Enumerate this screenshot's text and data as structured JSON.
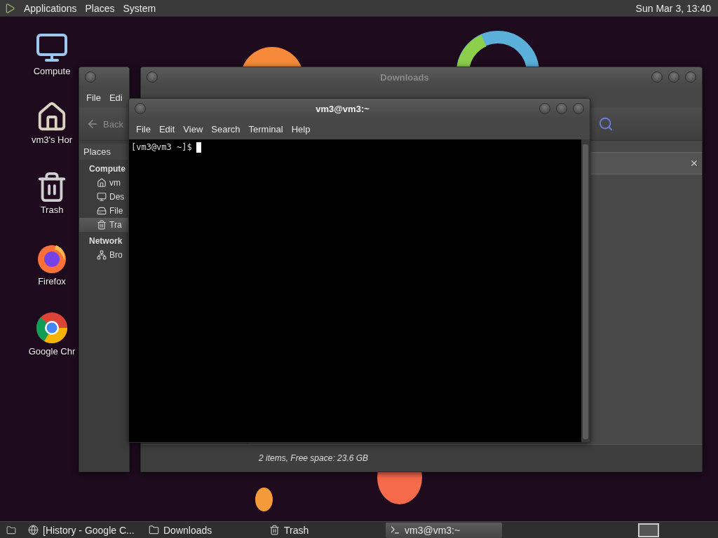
{
  "top_panel": {
    "menus": [
      "Applications",
      "Places",
      "System"
    ],
    "clock": "Sun Mar 3, 13:40"
  },
  "desktop_icons": [
    {
      "kind": "computer",
      "label": "Compute"
    },
    {
      "kind": "home",
      "label": "vm3's Hor"
    },
    {
      "kind": "trash",
      "label": "Trash"
    },
    {
      "kind": "firefox",
      "label": "Firefox"
    },
    {
      "kind": "chrome",
      "label": "Google Chr"
    }
  ],
  "trash_window": {
    "menus": [
      "File",
      "Edi"
    ],
    "back": "Back",
    "sidebar_title": "Places",
    "sections": [
      {
        "heading": "Compute",
        "items": [
          {
            "kind": "home",
            "label": "vm",
            "selected": false
          },
          {
            "kind": "desktop",
            "label": "Des",
            "selected": false
          },
          {
            "kind": "drive",
            "label": "File",
            "selected": false
          },
          {
            "kind": "trash",
            "label": "Tra",
            "selected": true
          }
        ]
      },
      {
        "heading": "Network",
        "items": [
          {
            "kind": "network",
            "label": "Bro",
            "selected": false
          }
        ]
      }
    ]
  },
  "downloads_window": {
    "title": "Downloads",
    "status": "2 items, Free space: 23.6 GB"
  },
  "terminal": {
    "title": "vm3@vm3:~",
    "menus": [
      "File",
      "Edit",
      "View",
      "Search",
      "Terminal",
      "Help"
    ],
    "prompt": "[vm3@vm3 ~]$"
  },
  "taskbar": {
    "items": [
      {
        "kind": "browser",
        "label": "[History - Google C...",
        "selected": false
      },
      {
        "kind": "folder",
        "label": "Downloads",
        "selected": false
      },
      {
        "kind": "trash",
        "label": "Trash",
        "selected": false
      },
      {
        "kind": "terminal",
        "label": "vm3@vm3:~",
        "selected": true
      }
    ]
  }
}
